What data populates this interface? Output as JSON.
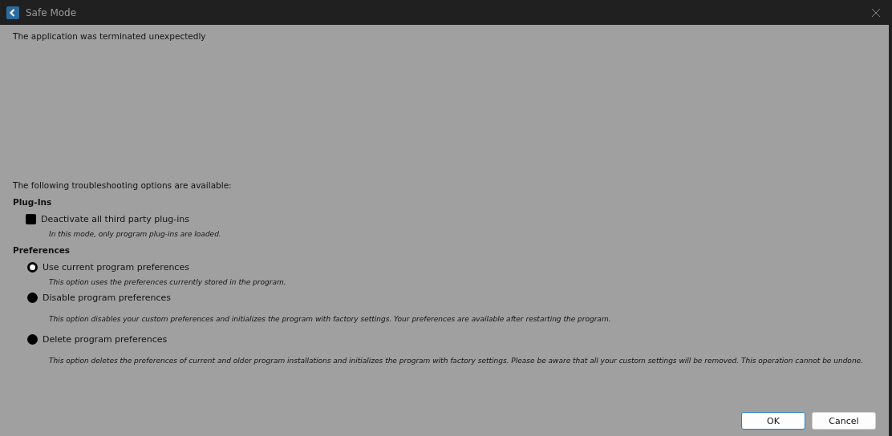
{
  "window": {
    "title": "Safe Mode"
  },
  "message": "The application was terminated unexpectedly",
  "intro": "The following troubleshooting options are available:",
  "plugins": {
    "heading": "Plug-Ins",
    "label": "Deactivate all third party plug-ins",
    "checked": false,
    "description": "In this mode, only program plug-ins are loaded."
  },
  "preferences": {
    "heading": "Preferences",
    "options": [
      {
        "label": "Use current program preferences",
        "selected": true,
        "description": "This option uses the preferences currently stored in the program."
      },
      {
        "label": "Disable program preferences",
        "selected": false,
        "description": "This option disables your custom preferences and initializes the program with factory settings. Your preferences are available after restarting the program."
      },
      {
        "label": "Delete program preferences",
        "selected": false,
        "description": "This option deletes the preferences of current and older program installations and initializes the program with factory settings. Please be aware that all your custom settings will be removed. This operation cannot be undone."
      }
    ]
  },
  "buttons": [
    {
      "label": "OK",
      "kind": "default"
    },
    {
      "label": "Cancel",
      "kind": "normal"
    }
  ]
}
